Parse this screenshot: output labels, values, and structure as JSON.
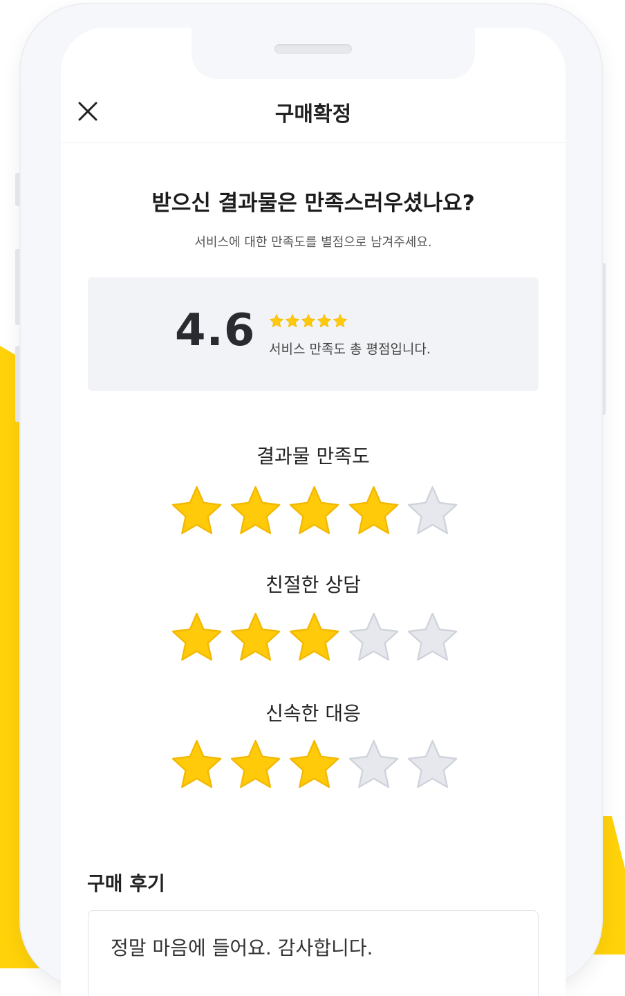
{
  "header": {
    "title": "구매확정"
  },
  "prompt": {
    "question": "받으신 결과물은 만족스러우셨나요?",
    "subtitle": "서비스에 대한 만족도를 별점으로 남겨주세요."
  },
  "summary": {
    "score": "4.6",
    "mini_stars": 5,
    "description": "서비스 만족도 총 평점입니다."
  },
  "ratings": [
    {
      "label": "결과물 만족도",
      "stars": 4,
      "max": 5
    },
    {
      "label": "친절한 상담",
      "stars": 3,
      "max": 5
    },
    {
      "label": "신속한 대응",
      "stars": 3,
      "max": 5
    }
  ],
  "review": {
    "label": "구매 후기",
    "text": "정말 마음에 들어요. 감사합니다."
  },
  "colors": {
    "accent": "#ffd20a",
    "star_filled": "#ffca0a",
    "star_empty": "#e6e8ee"
  }
}
